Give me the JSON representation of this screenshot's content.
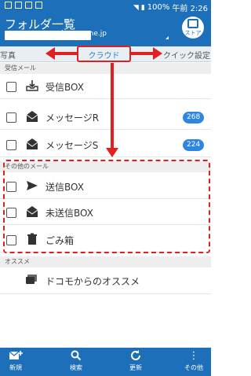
{
  "status_bar": {
    "battery": "100%",
    "time": "午前 2:26"
  },
  "header": {
    "title": "フォルダ一覧",
    "account_domain": "@docomo.ne.jp",
    "store_label": "ストア"
  },
  "tabs": {
    "photos": "写真",
    "cloud": "クラウド",
    "quick": "クイック設定"
  },
  "sections": {
    "received": "受信メール",
    "other": "その他のメール",
    "recommend": "オススメ"
  },
  "folders": {
    "inbox": {
      "label": "受信BOX",
      "icon": "inbox-icon"
    },
    "message_r": {
      "label": "メッセージR",
      "icon": "envelope-r-icon",
      "badge": "268"
    },
    "message_s": {
      "label": "メッセージS",
      "icon": "envelope-s-icon",
      "badge": "224"
    },
    "sent": {
      "label": "送信BOX",
      "icon": "send-icon"
    },
    "unsent": {
      "label": "未送信BOX",
      "icon": "envelope-open-icon"
    },
    "trash": {
      "label": "ごみ箱",
      "icon": "trash-icon"
    }
  },
  "recommend": {
    "label": "ドコモからのオススメ",
    "icon": "chat-icon"
  },
  "bottom_bar": {
    "new": "新規",
    "search": "検索",
    "refresh": "更新",
    "other": "その他"
  },
  "colors": {
    "primary": "#1c6fb8",
    "accent": "#2d87e0",
    "annotation": "#e02020"
  }
}
